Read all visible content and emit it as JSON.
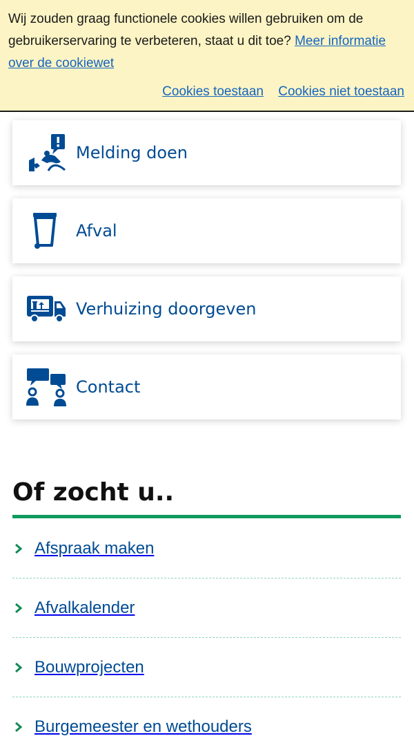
{
  "cookie_banner": {
    "message": "Wij zouden graag functionele cookies willen gebruiken om de gebruikerservaring te verbeteren, staat u dit toe?",
    "more_info_link": "Meer informatie over de cookiewet",
    "allow_label": "Cookies toestaan",
    "deny_label": "Cookies niet toestaan"
  },
  "tasks": [
    {
      "label": "Melding doen",
      "icon": "report-icon"
    },
    {
      "label": "Afval",
      "icon": "waste-bin-icon"
    },
    {
      "label": "Verhuizing doorgeven",
      "icon": "moving-truck-icon"
    },
    {
      "label": "Contact",
      "icon": "contact-icon"
    }
  ],
  "related": {
    "title": "Of zocht u..",
    "links": [
      "Afspraak maken",
      "Afvalkalender",
      "Bouwprojecten",
      "Burgemeester en wethouders"
    ]
  },
  "colors": {
    "banner_bg": "#fcf4c4",
    "link_blue": "#1565c0",
    "brand_blue": "#004b93",
    "accent_green": "#0f9a5e"
  }
}
